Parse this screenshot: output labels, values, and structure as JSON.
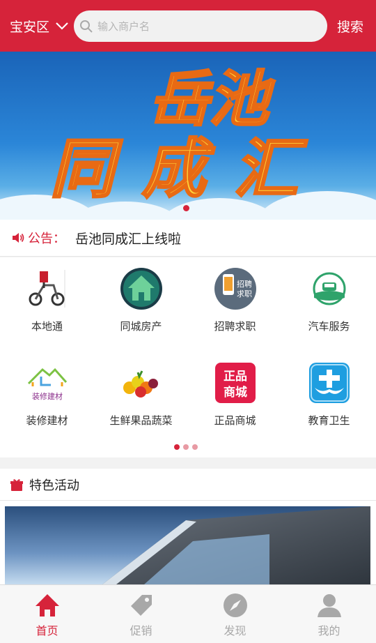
{
  "header": {
    "district": "宝安区",
    "search_placeholder": "输入商户名",
    "search_button": "搜索"
  },
  "banner": {
    "line1": "岳池",
    "line2": "同成汇",
    "page_count": 1,
    "active_page": 1
  },
  "notice": {
    "label": "公告：",
    "text": "岳池同成汇上线啦"
  },
  "categories": [
    {
      "label": "本地通",
      "icon": "scooter-icon"
    },
    {
      "label": "同城房产",
      "icon": "house-icon"
    },
    {
      "label": "招聘求职",
      "icon": "recruitment-icon"
    },
    {
      "label": "汽车服务",
      "icon": "car-icon"
    },
    {
      "label": "装修建材",
      "icon": "decoration-icon"
    },
    {
      "label": "生鲜果品蔬菜",
      "icon": "fruit-icon"
    },
    {
      "label": "正品商城",
      "icon": "mall-icon"
    },
    {
      "label": "教育卫生",
      "icon": "education-icon"
    }
  ],
  "category_pager": {
    "pages": 3,
    "active": 1
  },
  "featured": {
    "title": "特色活动"
  },
  "tabs": [
    {
      "label": "首页",
      "icon": "home-icon",
      "active": true
    },
    {
      "label": "促销",
      "icon": "tag-icon",
      "active": false
    },
    {
      "label": "发现",
      "icon": "compass-icon",
      "active": false
    },
    {
      "label": "我的",
      "icon": "user-icon",
      "active": false
    }
  ],
  "colors": {
    "brand": "#d6233a",
    "inactive": "#a8a8a8"
  }
}
